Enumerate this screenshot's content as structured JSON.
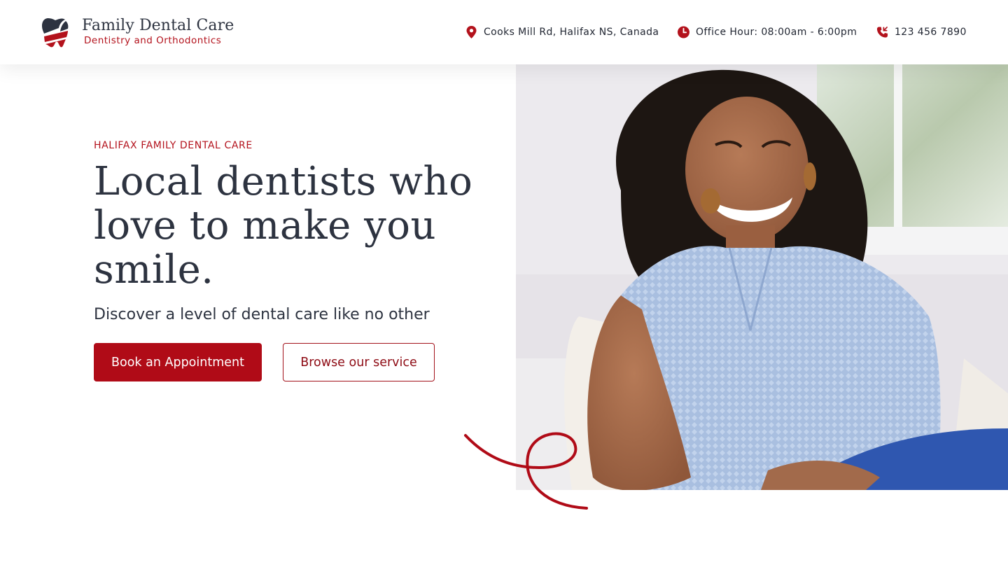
{
  "brand": {
    "name": "Family Dental Care",
    "tagline": "Dentistry and Orthodontics",
    "logo_icon": "tooth-logo-icon"
  },
  "contact": {
    "address": "Cooks Mill Rd, Halifax NS, Canada",
    "hours": "Office Hour: 08:00am - 6:00pm",
    "phone": "123 456 7890",
    "icons": [
      "location-pin-icon",
      "clock-icon",
      "phone-icon"
    ]
  },
  "hero": {
    "eyebrow": "HALIFAX FAMILY DENTAL CARE",
    "headline": "Local dentists who love to make you smile.",
    "subheadline": "Discover a level of dental care like no other",
    "primary_button": "Book an Appointment",
    "secondary_button": "Browse our service",
    "image_subject": "smiling woman in light blue blouse"
  },
  "colors": {
    "accent": "#b00b17",
    "text_dark": "#2d3340",
    "background": "#ffffff"
  }
}
